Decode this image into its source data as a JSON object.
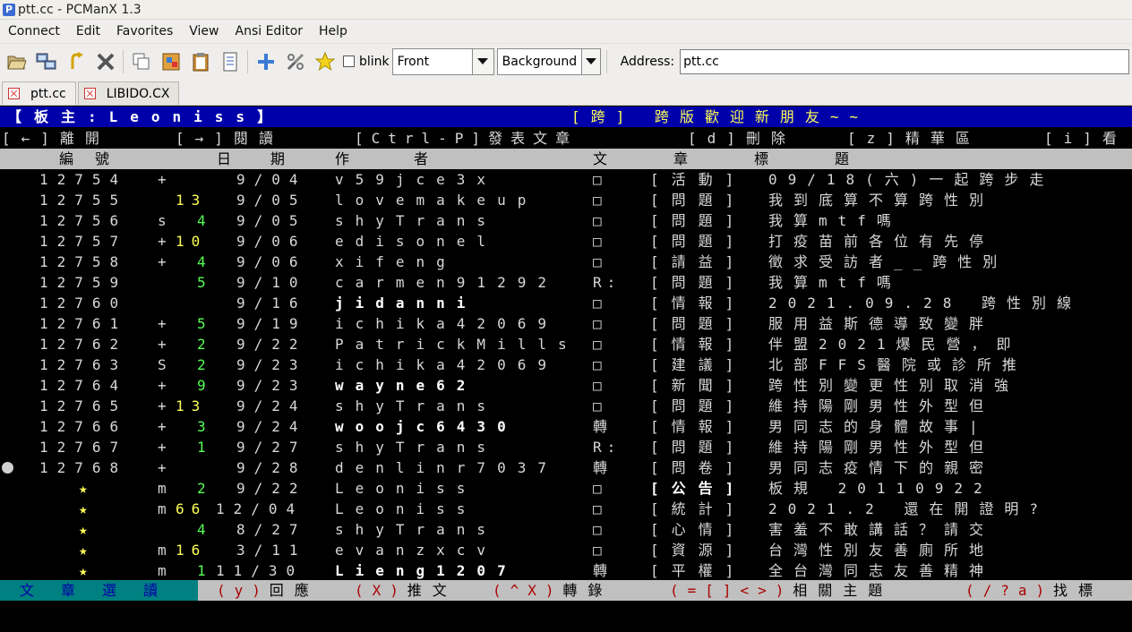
{
  "window": {
    "title": "ptt.cc - PCManX 1.3",
    "app_icon_letter": "P"
  },
  "menu": [
    "Connect",
    "Edit",
    "Favorites",
    "View",
    "Ansi Editor",
    "Help"
  ],
  "toolbar": {
    "icons": [
      "open-folder-icon",
      "connect-icon",
      "reconnect-icon",
      "close-connection-icon",
      "copy-icon",
      "paste-icon",
      "clipboard-icon",
      "document-icon",
      "add-icon",
      "settings-icon",
      "favorite-star-icon"
    ],
    "blink_label": "blink",
    "blink_checked": false,
    "front_value": "Front",
    "background_value": "Background",
    "address_label": "Address:",
    "address_value": "ptt.cc"
  },
  "tabs": [
    {
      "label": "ptt.cc",
      "active": true
    },
    {
      "label": "LIBIDO.CX",
      "active": false
    }
  ],
  "terminal": {
    "header_left": "【板主:Leoniss】",
    "header_right": "[跨] 跨版歡迎新朋友~~",
    "help_segments": [
      "[←]離開",
      "[→]閱讀",
      "[Ctrl-P]發表文章",
      "[d]刪除",
      "[z]精華區",
      "[i]看"
    ],
    "col_headers": {
      "num": "編號",
      "date": "日期",
      "author": "作者",
      "title": "文章標題"
    },
    "rows": [
      {
        "num": "12754",
        "mark": "+",
        "push": "",
        "date": "9/04",
        "author": "v59jce3x",
        "bold": false,
        "type": "□",
        "cat": "[活動]",
        "title": "09/18(六)一起跨步走"
      },
      {
        "num": "12755",
        "mark": "",
        "push": "13",
        "date": "9/05",
        "author": "lovemakeup",
        "bold": false,
        "type": "□",
        "cat": "[問題]",
        "title": "我到底算不算跨性別"
      },
      {
        "num": "12756",
        "mark": "s",
        "push": "4",
        "date": "9/05",
        "author": "shyTrans",
        "bold": false,
        "type": "□",
        "cat": "[問題]",
        "title": "我算mtf嗎"
      },
      {
        "num": "12757",
        "mark": "+",
        "push": "10",
        "date": "9/06",
        "author": "edisonel",
        "bold": false,
        "type": "□",
        "cat": "[問題]",
        "title": "打疫苗前各位有先停"
      },
      {
        "num": "12758",
        "mark": "+",
        "push": "4",
        "date": "9/06",
        "author": "xifeng",
        "bold": false,
        "type": "□",
        "cat": "[請益]",
        "title": "徵求受訪者__跨性別"
      },
      {
        "num": "12759",
        "mark": "",
        "push": "5",
        "date": "9/10",
        "author": "carmen91292",
        "bold": false,
        "type": "R:",
        "cat": "[問題]",
        "title": "我算mtf嗎"
      },
      {
        "num": "12760",
        "mark": "",
        "push": "",
        "date": "9/16",
        "author": "jidanni",
        "bold": true,
        "type": "□",
        "cat": "[情報]",
        "title": "2021.09.28 跨性別線"
      },
      {
        "num": "12761",
        "mark": "+",
        "push": "5",
        "date": "9/19",
        "author": "ichika42069",
        "bold": false,
        "type": "□",
        "cat": "[問題]",
        "title": "服用益斯德導致變胖"
      },
      {
        "num": "12762",
        "mark": "+",
        "push": "2",
        "date": "9/22",
        "author": "PatrickMills",
        "bold": false,
        "type": "□",
        "cat": "[情報]",
        "title": "伴盟2021爆民營，即"
      },
      {
        "num": "12763",
        "mark": "S",
        "push": "2",
        "date": "9/23",
        "author": "ichika42069",
        "bold": false,
        "type": "□",
        "cat": "[建議]",
        "title": "北部FFS醫院或診所推"
      },
      {
        "num": "12764",
        "mark": "+",
        "push": "9",
        "date": "9/23",
        "author": "wayne62",
        "bold": true,
        "type": "□",
        "cat": "[新聞]",
        "title": "跨性別變更性別取消強"
      },
      {
        "num": "12765",
        "mark": "+",
        "push": "13",
        "date": "9/24",
        "author": "shyTrans",
        "bold": false,
        "type": "□",
        "cat": "[問題]",
        "title": "維持陽剛男性外型但"
      },
      {
        "num": "12766",
        "mark": "+",
        "push": "3",
        "date": "9/24",
        "author": "woojc6430",
        "bold": true,
        "type": "轉",
        "cat": "[情報]",
        "title": "男同志的身體故事|"
      },
      {
        "num": "12767",
        "mark": "+",
        "push": "1",
        "date": "9/27",
        "author": "shyTrans",
        "bold": false,
        "type": "R:",
        "cat": "[問題]",
        "title": "維持陽剛男性外型但"
      },
      {
        "num": "12768",
        "mark": "+",
        "push": "",
        "date": "9/28",
        "author": "denlinr7037",
        "bold": false,
        "type": "轉",
        "cat": "[問卷]",
        "title": "男同志疫情下的親密"
      },
      {
        "num": "★",
        "mark": "m",
        "push": "2",
        "date": "9/22",
        "author": "Leoniss",
        "bold": false,
        "type": "□",
        "cat": "[公告]",
        "cat_bold": true,
        "title": "板規 20110922"
      },
      {
        "num": "★",
        "mark": "m",
        "push": "66",
        "date": "12/04",
        "author": "Leoniss",
        "bold": false,
        "type": "□",
        "cat": "[統計]",
        "title": "2021.2 還在開證明?"
      },
      {
        "num": "★",
        "mark": "",
        "push": "4",
        "date": "8/27",
        "author": "shyTrans",
        "bold": false,
        "type": "□",
        "cat": "[心情]",
        "title": "害羞不敢講話？請交"
      },
      {
        "num": "★",
        "mark": "m",
        "push": "16",
        "date": "3/11",
        "author": "evanzxcv",
        "bold": false,
        "type": "□",
        "cat": "[資源]",
        "title": "台灣性別友善廁所地"
      },
      {
        "num": "★",
        "mark": "m",
        "push": "1",
        "date": "11/30",
        "author": "Lieng1207",
        "bold": true,
        "type": "轉",
        "cat": "[平權]",
        "title": "全台灣同志友善精神"
      }
    ],
    "cursor_row": 14,
    "footer_mode": "文章選讀",
    "footer_items": [
      {
        "key": "(y)",
        "label": "回應"
      },
      {
        "key": "(X)",
        "label": "推文"
      },
      {
        "key": "(^X)",
        "label": "轉錄"
      },
      {
        "key": "(=[]<>)",
        "label": "相關主題"
      },
      {
        "key": "(/?a)",
        "label": "找標"
      }
    ]
  },
  "colors": {
    "header_bg": "#0000aa",
    "footer_mode_bg": "#008080",
    "push_yellow": "#ffff55",
    "push_green": "#55ff55"
  }
}
